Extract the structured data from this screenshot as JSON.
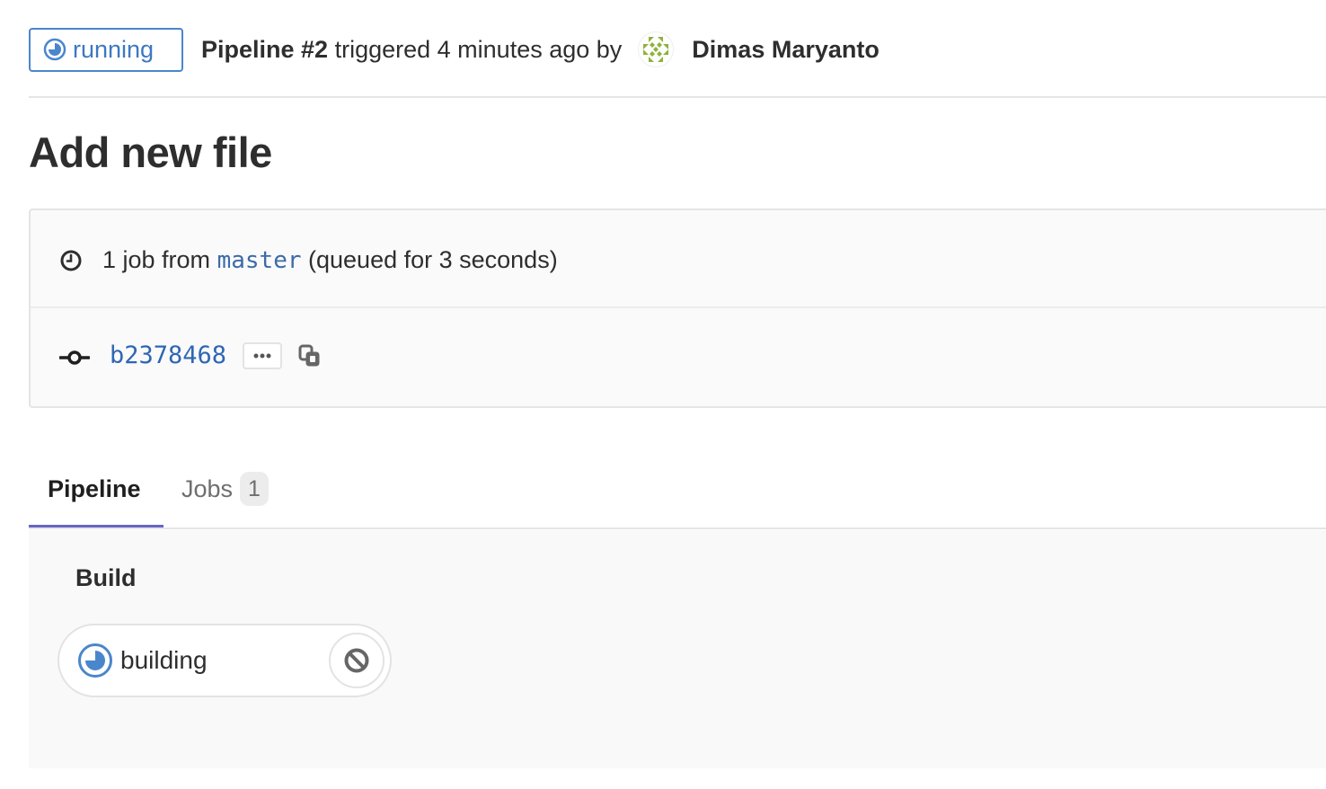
{
  "header": {
    "status": {
      "label": "running",
      "icon": "status-running-icon",
      "color": "#4a86cc"
    },
    "pipeline_label": "Pipeline #2",
    "triggered_text": "triggered 4 minutes ago by",
    "author": {
      "name": "Dimas Maryanto",
      "avatar": "identicon-avatar",
      "avatar_color": "#8fb23c"
    }
  },
  "title": "Add new file",
  "info": {
    "job_count_text": "1 job from",
    "branch": "master",
    "queued_text": "(queued for 3 seconds)",
    "commit_sha": "b2378468",
    "more_label": "•••",
    "copy_icon": "copy-icon"
  },
  "tabs": [
    {
      "label": "Pipeline",
      "active": true
    },
    {
      "label": "Jobs",
      "count": "1",
      "active": false
    }
  ],
  "pipeline": {
    "stages": [
      {
        "title": "Build",
        "jobs": [
          {
            "name": "building",
            "status": "running",
            "action": "cancel"
          }
        ]
      }
    ]
  },
  "colors": {
    "accent_blue": "#4a86cc",
    "link_blue": "#2f66b3",
    "tab_active": "#6666c4"
  }
}
